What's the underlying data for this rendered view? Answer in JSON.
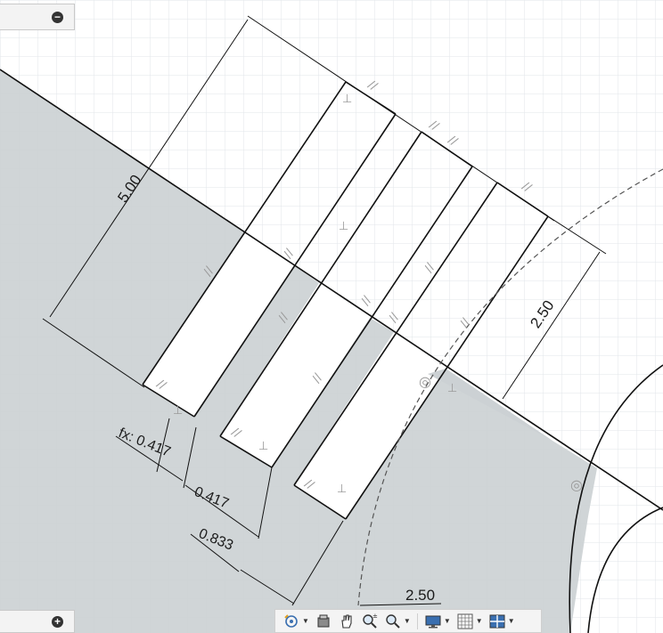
{
  "dimensions": {
    "width_5": "5.00",
    "offset_2_5": "2.50",
    "fx_label": "fx: 0.417",
    "spacing_0417": "0.417",
    "spacing_0833": "0.833",
    "radius_2_5": "2.50"
  },
  "constraints": {
    "parallel": "//",
    "perpendicular": "⊥",
    "coincident": "◎"
  },
  "panels": {
    "top_collapse": "−",
    "bottom_expand": "+"
  },
  "navbar": {
    "tools": [
      {
        "name": "orbit-icon",
        "has_caret": true
      },
      {
        "name": "look-at-icon",
        "has_caret": false
      },
      {
        "name": "pan-icon",
        "has_caret": false
      },
      {
        "name": "zoom-icon",
        "has_caret": false
      },
      {
        "name": "zoom-window-icon",
        "has_caret": true
      },
      {
        "name": "display-settings-icon",
        "has_caret": true
      },
      {
        "name": "grid-icon",
        "has_caret": true
      },
      {
        "name": "viewports-icon",
        "has_caret": true
      }
    ]
  },
  "colors": {
    "background": "#ffffff",
    "grid": "#e2e6ea",
    "shaded_region": "#ccd1d4",
    "sketch_line": "#111111",
    "constraint": "#9a9a9a"
  }
}
